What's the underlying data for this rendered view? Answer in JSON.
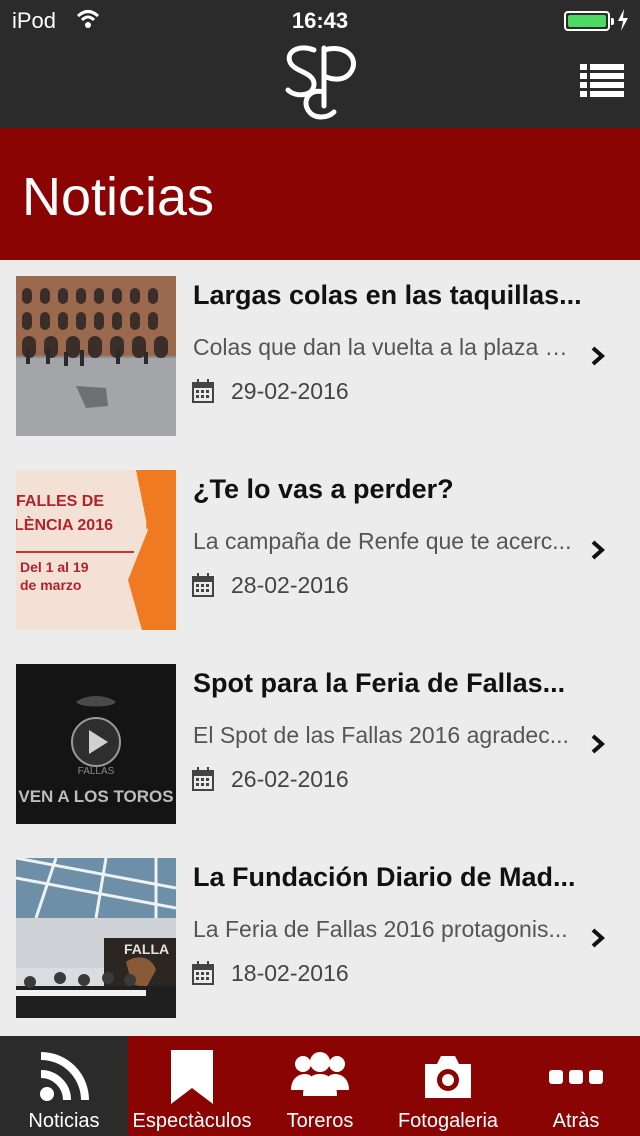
{
  "status_bar": {
    "carrier": "iPod",
    "time": "16:43",
    "battery_color": "#4cd964"
  },
  "header": {
    "logo_text": "SCP",
    "menu_icon": "list-menu-icon"
  },
  "page": {
    "title": "Noticias"
  },
  "news": [
    {
      "title": "Largas colas en las taquillas...",
      "summary": "Colas que dan la vuelta a la plaza e...",
      "date": "29-02-2016",
      "thumb": "bullring-exterior"
    },
    {
      "title": "¿Te lo vas a perder?",
      "summary": "La campaña de Renfe que te acerc...",
      "date": "28-02-2016",
      "thumb": "fallas-poster",
      "thumb_text": [
        "FALLES DE",
        "LÈNCIA 2016",
        "Del 1 al 19",
        "de marzo"
      ]
    },
    {
      "title": "Spot para la Feria de Fallas...",
      "summary": "El Spot de las Fallas 2016 agradec...",
      "date": "26-02-2016",
      "thumb": "video-still",
      "thumb_text": [
        "FALLAS",
        "VEN A LOS TOROS"
      ]
    },
    {
      "title": "La Fundación Diario de Mad...",
      "summary": "La Feria de Fallas 2016 protagonis...",
      "date": "18-02-2016",
      "thumb": "press-conference",
      "thumb_text": [
        "FALLA"
      ]
    }
  ],
  "tabs": [
    {
      "label": "Noticias",
      "icon": "rss-icon",
      "active": true
    },
    {
      "label": "Espectàculos",
      "icon": "bookmark-icon",
      "active": false
    },
    {
      "label": "Toreros",
      "icon": "users-icon",
      "active": false
    },
    {
      "label": "Fotogaleria",
      "icon": "camera-icon",
      "active": false
    },
    {
      "label": "Atràs",
      "icon": "more-dots-icon",
      "active": false
    }
  ],
  "colors": {
    "brand_red": "#8a0404",
    "header_dark": "#2b2b2b",
    "list_bg": "#ececec"
  }
}
